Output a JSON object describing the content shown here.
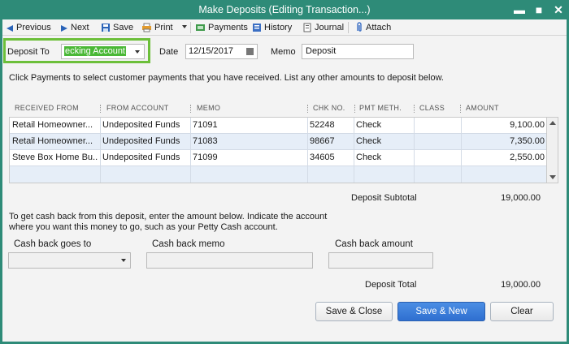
{
  "window": {
    "title": "Make Deposits (Editing Transaction...)",
    "minimize": "▬",
    "maximize": "■",
    "close": "✕"
  },
  "toolbar": {
    "previous": "Previous",
    "next": "Next",
    "save": "Save",
    "print": "Print",
    "payments": "Payments",
    "history": "History",
    "journal": "Journal",
    "attach": "Attach"
  },
  "header": {
    "deposit_to_label": "Deposit To",
    "deposit_to_value": "ecking Account",
    "date_label": "Date",
    "date_value": "12/15/2017",
    "memo_label": "Memo",
    "memo_value": "Deposit"
  },
  "instructions": "Click Payments to select customer payments that you have received. List any other amounts to deposit below.",
  "table": {
    "columns": [
      "RECEIVED FROM",
      "FROM ACCOUNT",
      "MEMO",
      "CHK NO.",
      "PMT METH.",
      "CLASS",
      "AMOUNT"
    ],
    "rows": [
      [
        "Retail Homeowner...",
        "Undeposited Funds",
        "71091",
        "52248",
        "Check",
        "",
        "9,100.00"
      ],
      [
        "Retail Homeowner...",
        "Undeposited Funds",
        "71083",
        "98667",
        "Check",
        "",
        "7,350.00"
      ],
      [
        "Steve Box Home Bu...",
        "Undeposited Funds",
        "71099",
        "34605",
        "Check",
        "",
        "2,550.00"
      ]
    ]
  },
  "subtotal": {
    "label": "Deposit Subtotal",
    "value": "19,000.00"
  },
  "cashback": {
    "instructions_line1": "To get cash back from this deposit, enter the amount below.  Indicate the account",
    "instructions_line2": "where you want this money to go, such as your Petty Cash account.",
    "goes_to_label": "Cash back goes to",
    "goes_to_value": "",
    "memo_label": "Cash back memo",
    "memo_value": "",
    "amount_label": "Cash back amount",
    "amount_value": ""
  },
  "total": {
    "label": "Deposit Total",
    "value": "19,000.00"
  },
  "buttons": {
    "save_close": "Save & Close",
    "save_new": "Save & New",
    "clear": "Clear"
  },
  "colors": {
    "titlebar": "#2e8b78",
    "highlight_box": "#6cbf3a",
    "primary_button": "#2f6fd0",
    "row_alt": "#e6eef8"
  }
}
